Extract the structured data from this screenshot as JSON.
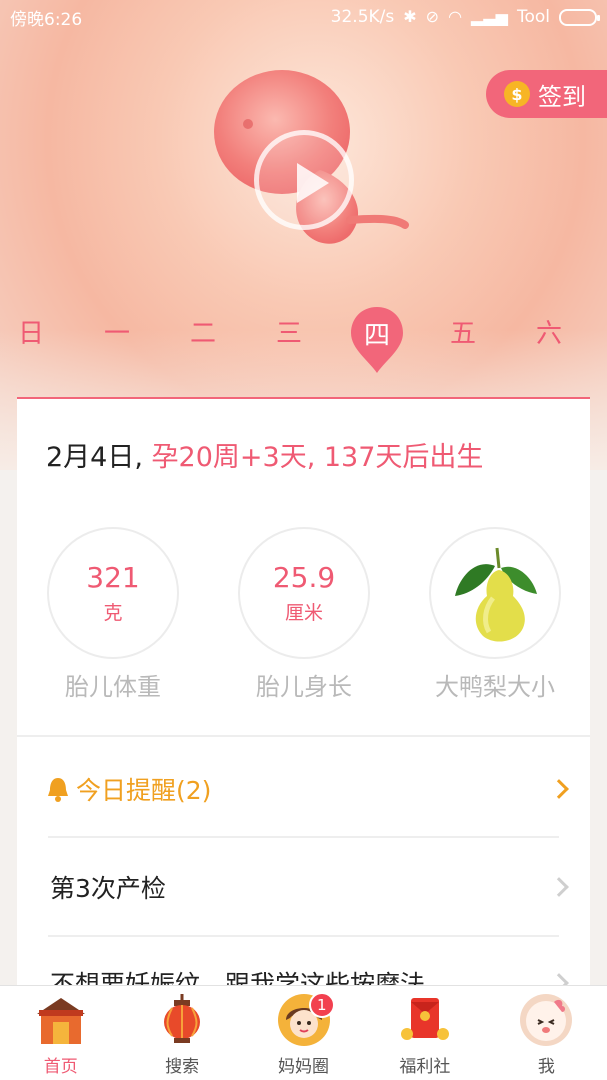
{
  "status_bar": {
    "time": "傍晚6:26",
    "network_speed": "32.5K/s",
    "carrier": "Tool"
  },
  "hero": {
    "checkin_label": "签到",
    "coin_symbol": "$"
  },
  "weekdays": [
    "日",
    "一",
    "二",
    "三",
    "四",
    "五",
    "六"
  ],
  "weekdays_active": "四",
  "summary": {
    "date": "2月4日,",
    "pregnancy": "孕20周+3天, 137天后出生"
  },
  "stats": [
    {
      "value": "321",
      "unit": "克",
      "label": "胎儿体重"
    },
    {
      "value": "25.9",
      "unit": "厘米",
      "label": "胎儿身长"
    },
    {
      "label": "大鸭梨大小",
      "image": "pear-image"
    }
  ],
  "reminder": {
    "label": "今日提醒(2)"
  },
  "rows": [
    {
      "label": "第3次产检"
    },
    {
      "label": "不想要妊娠纹，跟我学这些按摩法"
    }
  ],
  "tabs": [
    {
      "label": "首页",
      "icon": "home-house-icon"
    },
    {
      "label": "搜索",
      "icon": "lantern-search-icon"
    },
    {
      "label": "妈妈圈",
      "icon": "mom-avatar-icon",
      "badge": "1"
    },
    {
      "label": "福利社",
      "icon": "red-envelope-icon"
    },
    {
      "label": "我",
      "icon": "baby-face-icon"
    }
  ],
  "colors": {
    "accent": "#ef5a73",
    "reminder": "#f0a020",
    "muted": "#b9b9b9"
  }
}
